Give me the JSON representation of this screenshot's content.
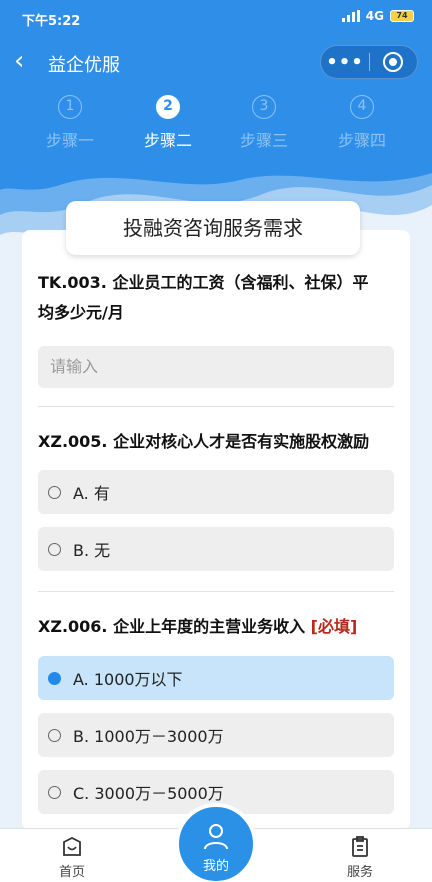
{
  "status_bar": {
    "time": "下午5:22",
    "network": "4G",
    "battery": "74"
  },
  "nav": {
    "title": "益企优服"
  },
  "steps": [
    {
      "num": "1",
      "label": "步骤一"
    },
    {
      "num": "2",
      "label": "步骤二"
    },
    {
      "num": "3",
      "label": "步骤三"
    },
    {
      "num": "4",
      "label": "步骤四"
    }
  ],
  "form": {
    "title": "投融资咨询服务需求",
    "q1": {
      "text_line1": "TK.003. 企业员工的工资（含福利、社保）平",
      "text_line2": "均多少元/月",
      "placeholder": "请输入"
    },
    "q2": {
      "text": "XZ.005. 企业对核心人才是否有实施股权激励",
      "options": [
        "A. 有",
        "B. 无"
      ]
    },
    "q3": {
      "text": "XZ.006. 企业上年度的主营业务收入 ",
      "required": "[必填]",
      "options": [
        "A. 1000万以下",
        "B. 1000万－3000万",
        "C. 3000万－5000万"
      ],
      "selected": "A. 1000万以下"
    }
  },
  "tabbar": {
    "home": "首页",
    "mine": "我的",
    "services": "服务"
  },
  "colors": {
    "primary": "#2f8fe8",
    "selected_bg": "#c7e4fb",
    "required": "#b9281e"
  }
}
